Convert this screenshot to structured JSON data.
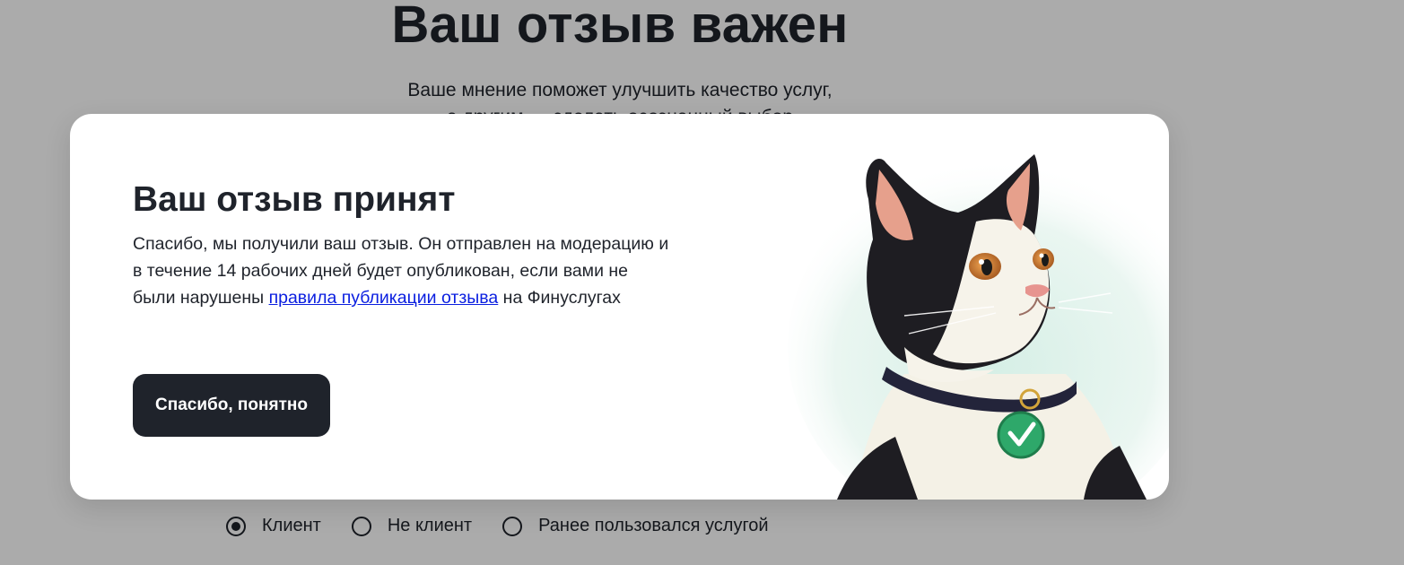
{
  "background": {
    "title": "Ваш отзыв важен",
    "subtitle_line1": "Ваше мнение поможет улучшить качество услуг,",
    "subtitle_line2": "а другим — сделать осознанный выбор"
  },
  "status_options": [
    {
      "label": "Клиент",
      "checked": true
    },
    {
      "label": "Не клиент",
      "checked": false
    },
    {
      "label": "Ранее пользовался услугой",
      "checked": false
    }
  ],
  "modal": {
    "title": "Ваш отзыв принят",
    "text_before": "Спасибо, мы получили ваш отзыв. Он отправлен на модерацию и в течение 14 рабочих дней будет опубликован, если вами не были нарушены ",
    "link_text": "правила публикации отзыва",
    "text_after": " на Финуслугах",
    "button_label": "Спасибо, понятно",
    "illustration": "cat-with-check-tag-illustration"
  },
  "colors": {
    "text": "#1f232b",
    "button_bg": "#1f232b",
    "link": "#0a1ee0",
    "tag_green": "#2ea86a",
    "overlay": "rgba(0,0,0,0.33)"
  }
}
